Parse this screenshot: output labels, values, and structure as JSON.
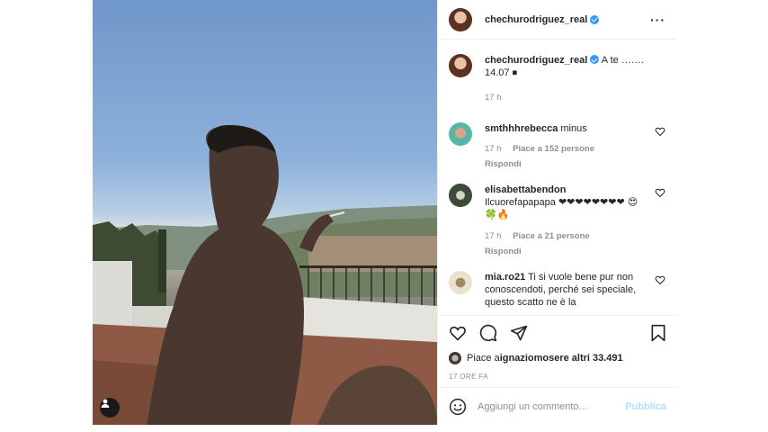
{
  "post": {
    "author": "chechurodriguez_real",
    "more_icon": "more-horizontal-icon",
    "caption_text": "A te ……. 14.07 ⏹",
    "caption_time": "17 h",
    "tag_icon": "user-tag-icon"
  },
  "comments": [
    {
      "user": "smthhhrebecca",
      "text": "minus",
      "time": "17 h",
      "likes": "Piace a 152 persone",
      "reply": "Rispondi"
    },
    {
      "user": "elisabettabendon",
      "text": "Ilcuorefapapapa ❤❤❤❤❤❤❤❤ 😍🍀🔥",
      "time": "17 h",
      "likes": "Piace a 21 persone",
      "reply": "Rispondi"
    },
    {
      "user": "mia.ro21",
      "text": "Ti si vuole bene pur non conoscendoti, perché sei speciale, questo scatto ne è la"
    }
  ],
  "actions": {
    "like_icon": "heart-icon",
    "comment_icon": "comment-icon",
    "share_icon": "share-icon",
    "save_icon": "bookmark-icon"
  },
  "likes": {
    "prefix": "Piace a ",
    "user": "ignaziomoser",
    "suffix": " e altri 33.491"
  },
  "timestamp": "17 ORE FA",
  "add_comment": {
    "placeholder": "Aggiungi un commento...",
    "publish_label": "Pubblica",
    "emoji_icon": "emoji-icon"
  }
}
